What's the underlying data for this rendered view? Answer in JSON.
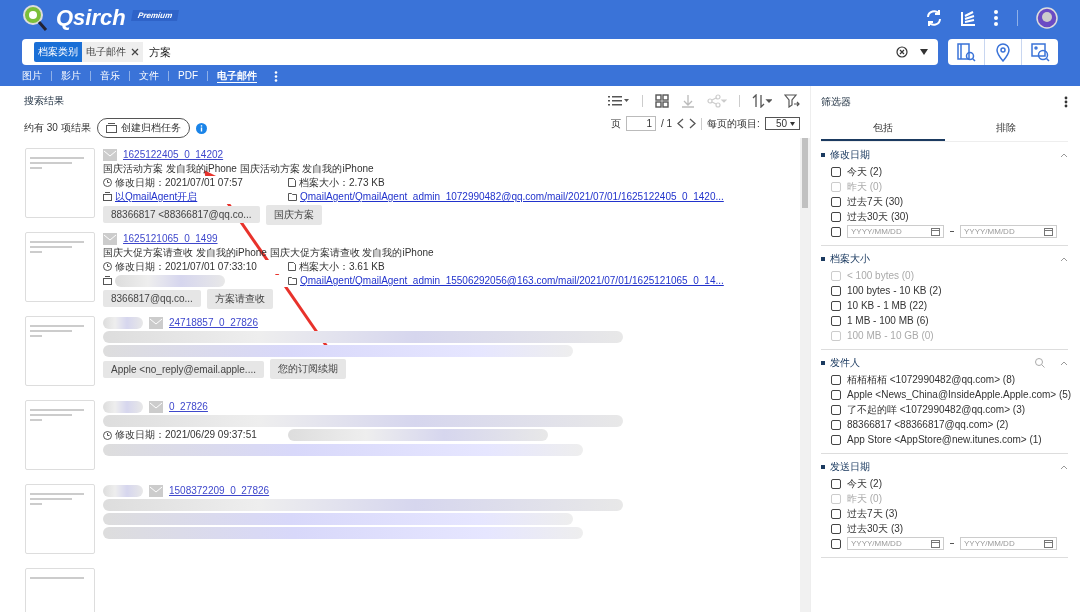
{
  "app": {
    "name": "Qsirch",
    "edition": "Premium"
  },
  "search": {
    "chips": [
      {
        "label": "档案类别",
        "kind": "key"
      },
      {
        "label": "电子邮件",
        "kind": "value"
      }
    ],
    "value": "方案"
  },
  "categories": [
    {
      "label": "图片",
      "selected": false
    },
    {
      "label": "影片",
      "selected": false
    },
    {
      "label": "音乐",
      "selected": false
    },
    {
      "label": "文件",
      "selected": false
    },
    {
      "label": "PDF",
      "selected": false
    },
    {
      "label": "电子邮件",
      "selected": true
    }
  ],
  "results": {
    "title": "搜索结果",
    "count": "约有 30 项结果",
    "archive_button": "创建归档任务",
    "page_label": "页",
    "page": "1",
    "page_total": "/ 1",
    "per_page_label": "每页的项目:",
    "per_page": "50"
  },
  "items": [
    {
      "kind": "clear",
      "title": "1625122405_0_14202",
      "snippet": "国庆活动方案 发自我的iPhone 国庆活动方案 发自我的iPhone",
      "modified": "修改日期：2021/07/01 07:57",
      "size": "档案大小：2.73 KB",
      "source": "以QmailAgent开启",
      "path": "QmailAgent/QmailAgent_admin_1072990482@qq.com/mail/2021/07/01/1625122405_0_1420...",
      "chips": [
        "88366817 <88366817@qq.co...",
        "国庆方案"
      ]
    },
    {
      "kind": "clear",
      "title": "1625121065_0_1499",
      "snippet": "国庆大促方案请查收 发自我的iPhone 国庆大促方案请查收 发自我的iPhone",
      "modified": "修改日期：2021/07/01 07:33:10",
      "size": "档案大小：3.61 KB",
      "path": "QmailAgent/QmailAgent_admin_15506292056@163.com/mail/2021/07/01/1625121065_0_14...",
      "chips": [
        "8366817@qq.co...",
        "方案请查收"
      ]
    },
    {
      "kind": "blurred",
      "title": "24718857_0_27826",
      "chips": [
        "Apple <no_reply@email.apple....",
        "您的订阅续期"
      ]
    },
    {
      "kind": "blurred",
      "title": "0_27826",
      "modified": "修改日期：2021/06/29 09:37:51"
    },
    {
      "kind": "blurred",
      "title": "1508372209_0_27826"
    }
  ],
  "filter": {
    "title": "筛选器",
    "tabs": [
      {
        "label": "包括",
        "selected": true
      },
      {
        "label": "排除",
        "selected": false
      }
    ],
    "sections": [
      {
        "title": "修改日期",
        "searchable": false,
        "options": [
          {
            "label": "今天 (2)",
            "disabled": false,
            "checked": false
          },
          {
            "label": "昨天 (0)",
            "disabled": true,
            "checked": false
          },
          {
            "label": "过去7天 (30)",
            "disabled": false,
            "checked": false
          },
          {
            "label": "过去30天 (30)",
            "disabled": false,
            "checked": false
          }
        ],
        "range": {
          "checked": false,
          "from_placeholder": "YYYY/MM/DD",
          "to_placeholder": "YYYY/MM/DD"
        }
      },
      {
        "title": "档案大小",
        "searchable": false,
        "options": [
          {
            "label": "< 100 bytes (0)",
            "disabled": true,
            "checked": false
          },
          {
            "label": "100 bytes - 10 KB (2)",
            "disabled": false,
            "checked": false
          },
          {
            "label": "10 KB - 1 MB (22)",
            "disabled": false,
            "checked": false
          },
          {
            "label": "1 MB - 100 MB (6)",
            "disabled": false,
            "checked": false
          },
          {
            "label": "100 MB - 10 GB (0)",
            "disabled": true,
            "checked": false
          }
        ]
      },
      {
        "title": "发件人",
        "searchable": true,
        "options": [
          {
            "label": "栢栢栢栢 <1072990482@qq.com> (8)",
            "disabled": false,
            "checked": false
          },
          {
            "label": "Apple <News_China@InsideApple.Apple.com> (5)",
            "disabled": false,
            "checked": false
          },
          {
            "label": "了不起的咩 <1072990482@qq.com> (3)",
            "disabled": false,
            "checked": false
          },
          {
            "label": "88366817 <88366817@qq.com> (2)",
            "disabled": false,
            "checked": false
          },
          {
            "label": "App Store <AppStore@new.itunes.com> (1)",
            "disabled": false,
            "checked": false
          }
        ]
      },
      {
        "title": "发送日期",
        "searchable": false,
        "options": [
          {
            "label": "今天 (2)",
            "disabled": false,
            "checked": false
          },
          {
            "label": "昨天 (0)",
            "disabled": true,
            "checked": false
          },
          {
            "label": "过去7天 (3)",
            "disabled": false,
            "checked": false
          },
          {
            "label": "过去30天 (3)",
            "disabled": false,
            "checked": false
          }
        ],
        "range": {
          "checked": false,
          "from_placeholder": "YYYY/MM/DD",
          "to_placeholder": "YYYY/MM/DD"
        }
      }
    ]
  }
}
